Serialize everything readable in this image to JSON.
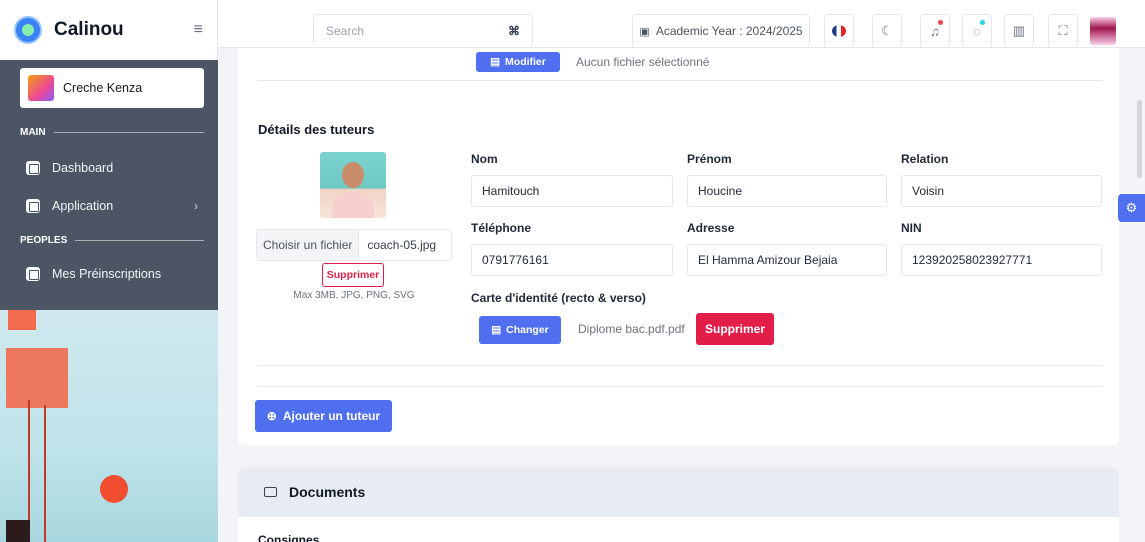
{
  "app": {
    "name": "Calinou"
  },
  "topbar": {
    "search_placeholder": "Search",
    "search_shortcut": "⌘",
    "academic_year_label": "Academic Year : 2024/2025"
  },
  "sidebar": {
    "school_name": "Creche Kenza",
    "sections": [
      {
        "label": "MAIN"
      },
      {
        "label": "PEOPLES"
      }
    ],
    "items": [
      {
        "label": "Dashboard"
      },
      {
        "label": "Application",
        "chevron": "›"
      },
      {
        "label": "Mes Préinscriptions"
      }
    ]
  },
  "top_file": {
    "button_label": "Modifier",
    "status": "Aucun fichier sélectionné"
  },
  "tutors": {
    "title": "Détails des tuteurs",
    "photo": {
      "choose_label": "Choisir un fichier",
      "file_name": "coach-05.jpg",
      "delete_label": "Supprimer",
      "hint": "Max 3MB, JPG, PNG, SVG"
    },
    "fields": {
      "nom": {
        "label": "Nom",
        "value": "Hamitouch"
      },
      "prenom": {
        "label": "Prénom",
        "value": "Houcine"
      },
      "relation": {
        "label": "Relation",
        "value": "Voisin"
      },
      "telephone": {
        "label": "Téléphone",
        "value": "0791776161"
      },
      "adresse": {
        "label": "Adresse",
        "value": "El Hamma Amizour Bejaia"
      },
      "nin": {
        "label": "NIN",
        "value": "123920258023927771"
      }
    },
    "id_card": {
      "label": "Carte d'identité (recto & verso)",
      "change_label": "Changer",
      "file_name": "Diplome bac.pdf.pdf",
      "delete_label": "Supprimer"
    },
    "add_button_label": "Ajouter un tuteur"
  },
  "documents": {
    "title": "Documents",
    "subtitle": "Consignes"
  },
  "colors": {
    "primary": "#4f6ff0",
    "danger": "#e11d48",
    "sidebar_bg": "#4b5563"
  }
}
